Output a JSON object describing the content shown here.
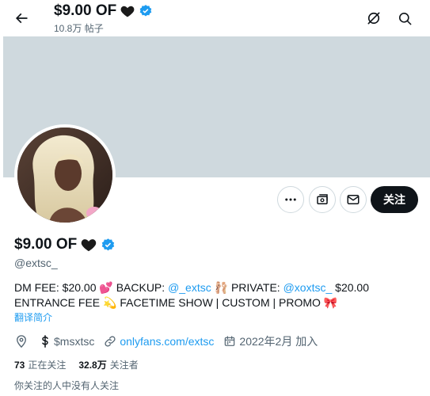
{
  "header": {
    "title": "$9.00 OF",
    "post_count": "10.8万 帖子"
  },
  "profile": {
    "display_name": "$9.00 OF",
    "handle": "@extsc_",
    "bio": {
      "part1": "DM FEE: $20.00 💕 BACKUP: ",
      "backup_link": "@_extsc",
      "part2": " 🩰 PRIVATE: ",
      "private_link": "@xoxtsc_",
      "part3": " $20.00 ENTRANCE FEE 💫 FACETIME SHOW | CUSTOM | PROMO 🎀"
    },
    "translate_label": "翻译简介",
    "cashtag": "$msxtsc",
    "website": "onlyfans.com/extsc",
    "joined": "2022年2月 加入",
    "following_count": "73",
    "following_label": "正在关注",
    "followers_count": "32.8万",
    "followers_label": "关注者",
    "followers_you_know": "你关注的人中没有人关注"
  },
  "actions": {
    "follow_label": "关注"
  },
  "colors": {
    "accent": "#1d9bf0",
    "banner": "#cfd9de",
    "text": "#0f1419",
    "secondary": "#536471",
    "follow_bg": "#0f1419"
  },
  "icons": {
    "back": "arrow-left-icon",
    "grok": "grok-icon",
    "search": "search-icon",
    "more": "more-icon",
    "subscribe": "subscription-icon",
    "message": "envelope-icon",
    "location": "location-pin-icon",
    "cash": "dollar-icon",
    "link": "link-icon",
    "calendar": "calendar-icon",
    "verified": "verified-badge-icon",
    "heart": "black-heart-icon"
  }
}
